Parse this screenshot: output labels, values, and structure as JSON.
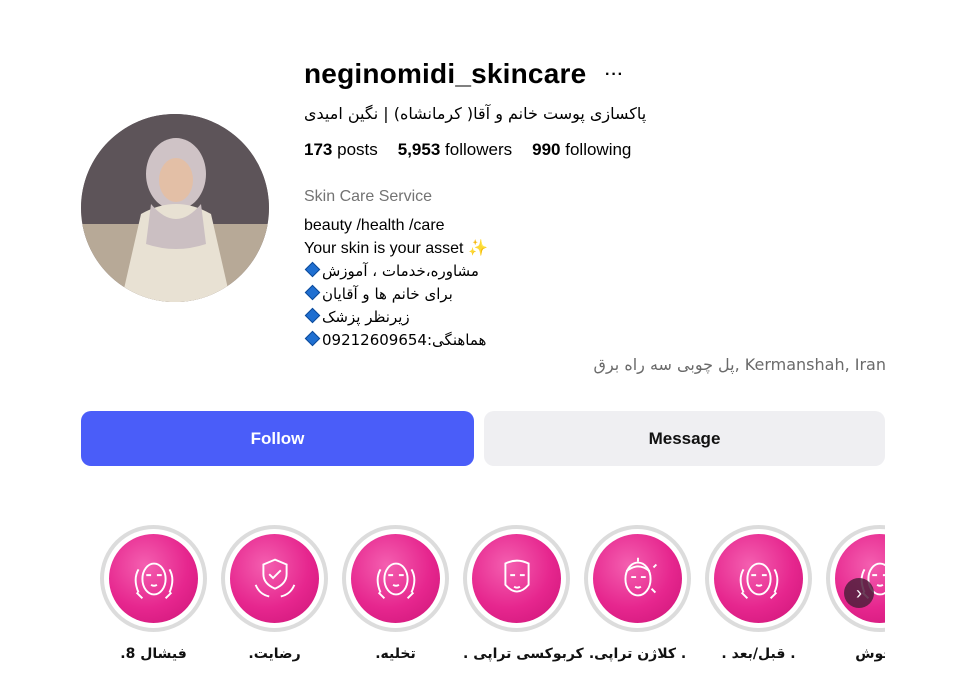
{
  "profile": {
    "username": "neginomidi_skincare",
    "more_icon": "ellipsis-icon",
    "full_name": "پاکسازی پوست خانم و آقا( کرمانشاه) | نگین امیدی",
    "stats": {
      "posts_count": "173",
      "posts_label": "posts",
      "followers_count": "5,953",
      "followers_label": "followers",
      "following_count": "990",
      "following_label": "following"
    },
    "category": "Skin Care Service",
    "bio": {
      "line1": "beauty /health /care",
      "line2": "Your skin is your asset",
      "line2_emoji": "✨",
      "line3": "مشاوره،خدمات ، آموزش",
      "line4": "برای خانم ها و آقایان",
      "line5": "زیرنظر پزشک",
      "line6": "هماهنگی:09212609654"
    },
    "location": "پل چوبی سه راه برق, Kermanshah, Iran"
  },
  "buttons": {
    "follow": "Follow",
    "message": "Message"
  },
  "highlights": [
    {
      "label": ".فیشال 8",
      "icon": "face-massage-icon"
    },
    {
      "label": ".رضایت",
      "icon": "shield-check-hands-icon"
    },
    {
      "label": ".تخلیه",
      "icon": "face-massage-icon"
    },
    {
      "label": ". کربوکسی تراپی",
      "icon": "face-mask-icon"
    },
    {
      "label": ".کلاژن تراپی .",
      "icon": "face-treatment-icon"
    },
    {
      "label": ". قبل/بعد .",
      "icon": "face-massage-icon"
    },
    {
      "label": "جوش .",
      "icon": "face-massage-icon"
    }
  ],
  "colors": {
    "follow_button": "#4a5df9",
    "message_button": "#efeff2",
    "highlight_pink": "#e6268e",
    "diamond": "#1f6fd1"
  }
}
